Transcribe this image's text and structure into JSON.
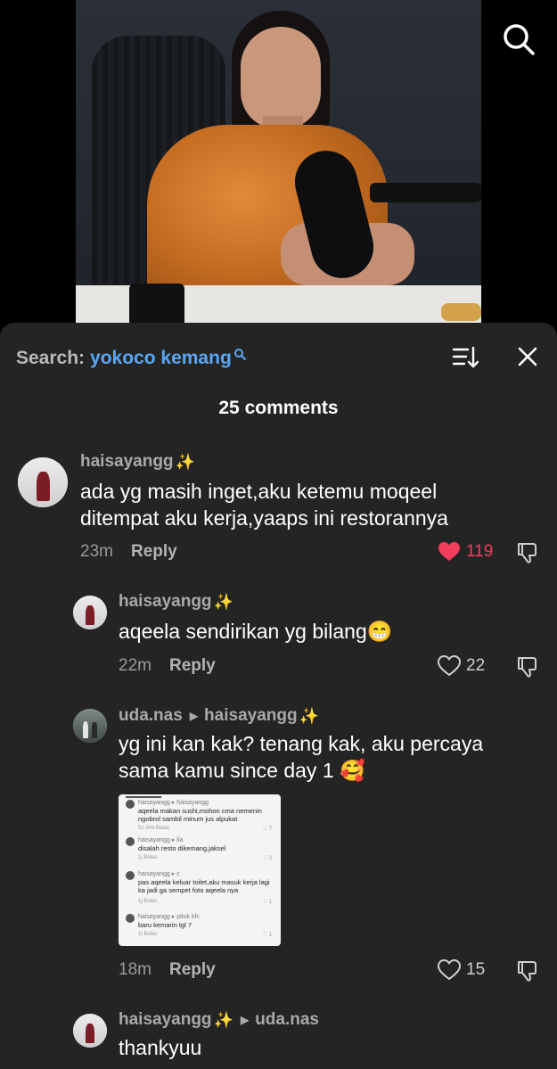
{
  "video": {
    "description_icon": "video-frame"
  },
  "top_search_icon": "search-icon",
  "sheet": {
    "search_label": "Search:",
    "search_query": "yokoco kemang",
    "comment_count": "25 comments"
  },
  "comments": [
    {
      "username": "haisayangg",
      "text_line1": "ada yg masih inget,aku ketemu moqeel",
      "text_line2": "ditempat aku kerja,yaaps ini restorannya",
      "time": "23m",
      "reply": "Reply",
      "likes": "119",
      "liked": true
    },
    {
      "username": "haisayangg",
      "text": "aqeela sendirikan yg bilang😁",
      "time": "22m",
      "reply": "Reply",
      "likes": "22"
    },
    {
      "username": "uda.nas",
      "reply_to": "haisayangg",
      "text_line1": "yg ini kan kak? tenang kak, aku percaya",
      "text_line2": "sama kamu since day 1 🥰",
      "time": "18m",
      "reply": "Reply",
      "likes": "15",
      "attachment": {
        "rows": [
          {
            "name": "haisayangg ▸ haisayangg",
            "text": "aqeela makan sushi,mohon cma nemenin ngobrol sambil minum jus alpukat",
            "meta": "51 mnt   Balas",
            "likes": "7"
          },
          {
            "name": "haisayangg ▸ lia",
            "text": "disalah resto dikemang,jaksel",
            "meta": "1j   Balas",
            "likes": "3"
          },
          {
            "name": "haisayangg ▸ c",
            "text": "pas aqeela keluar toilet,aku masuk kerja lagi ka jadi ga sempet foto aqeela nya",
            "meta": "1j   Balas",
            "likes": "1"
          },
          {
            "name": "haisayangg ▸ pitok kfc",
            "text": "baru kemarin tgl 7",
            "meta": "1j   Balas",
            "likes": "1"
          }
        ]
      }
    },
    {
      "username": "haisayangg",
      "reply_to": "uda.nas",
      "text": "thankyuu"
    }
  ]
}
